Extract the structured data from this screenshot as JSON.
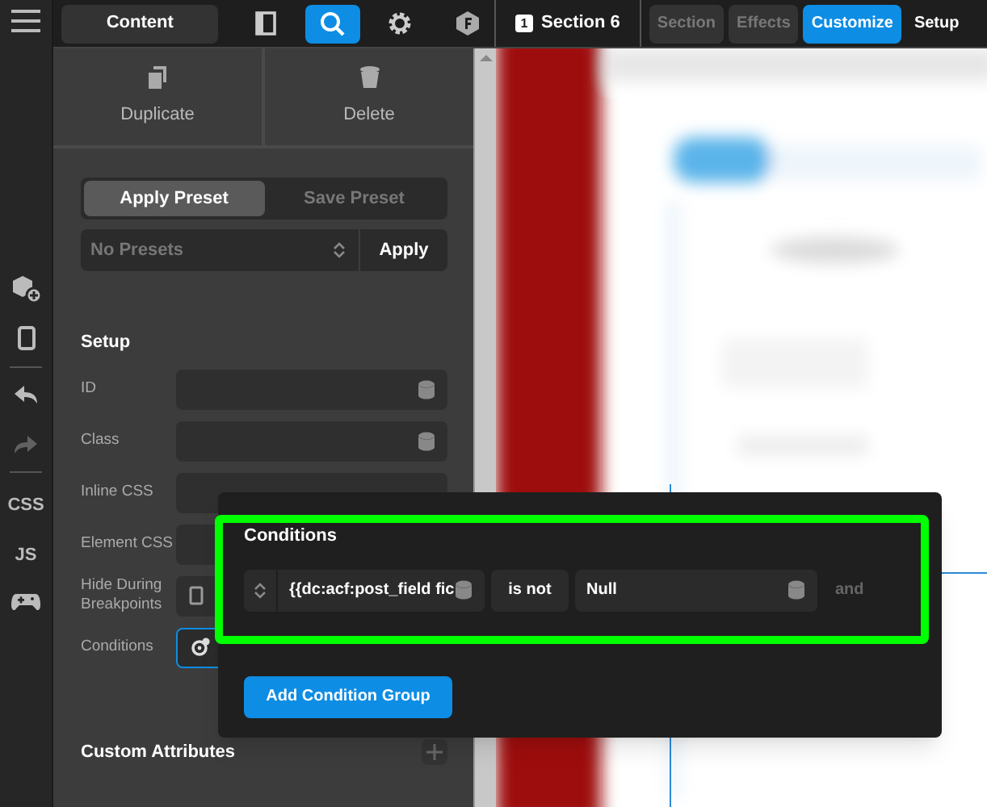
{
  "rail": {
    "items": [
      {
        "kind": "menu"
      },
      {
        "kind": "add-block"
      },
      {
        "kind": "tablet"
      },
      {
        "kind": "divider"
      },
      {
        "kind": "undo",
        "disabled": false
      },
      {
        "kind": "redo",
        "disabled": true
      },
      {
        "kind": "divider"
      },
      {
        "kind": "text",
        "label": "CSS"
      },
      {
        "kind": "text",
        "label": "JS"
      },
      {
        "kind": "gamepad"
      }
    ]
  },
  "toolbar": {
    "content_button": "Content",
    "tools": [
      {
        "kind": "panel",
        "selected": false
      },
      {
        "kind": "search",
        "selected": true
      },
      {
        "kind": "settings",
        "selected": false
      },
      {
        "kind": "badge",
        "selected": false
      }
    ]
  },
  "element_bar": {
    "index": "1",
    "label": "Section 6",
    "tabs": [
      {
        "label": "Section",
        "selected": false,
        "disabled": true
      },
      {
        "label": "Effects",
        "selected": false,
        "disabled": true
      },
      {
        "label": "Customize",
        "selected": true,
        "disabled": false
      },
      {
        "label": "Setup",
        "selected": false,
        "disabled": false
      }
    ]
  },
  "actions": [
    {
      "kind": "duplicate",
      "label": "Duplicate"
    },
    {
      "kind": "delete",
      "label": "Delete"
    }
  ],
  "presets": {
    "tabs": [
      {
        "label": "Apply Preset",
        "selected": true
      },
      {
        "label": "Save Preset",
        "selected": false
      }
    ],
    "select": {
      "value": "No Presets"
    },
    "apply_button": "Apply"
  },
  "setup": {
    "title": "Setup",
    "fields": [
      {
        "label": "ID",
        "kind": "text",
        "focused": false
      },
      {
        "label": "Class",
        "kind": "text",
        "focused": false
      },
      {
        "label": "Inline CSS",
        "kind": "code",
        "focused": false
      },
      {
        "label": "Element CSS",
        "kind": "code",
        "focused": false
      },
      {
        "label": "Hide During Breakpoints",
        "kind": "breakpoints",
        "focused": false
      },
      {
        "label": "Conditions",
        "kind": "conditions",
        "focused": true
      }
    ]
  },
  "custom_attributes": {
    "title": "Custom Attributes"
  },
  "conditions_popover": {
    "title": "Conditions",
    "condition": {
      "field": "{{dc:acf:post_field fic",
      "operator": "is not",
      "value": "Null",
      "joiner": "and"
    },
    "add_group_button": "Add Condition Group"
  }
}
